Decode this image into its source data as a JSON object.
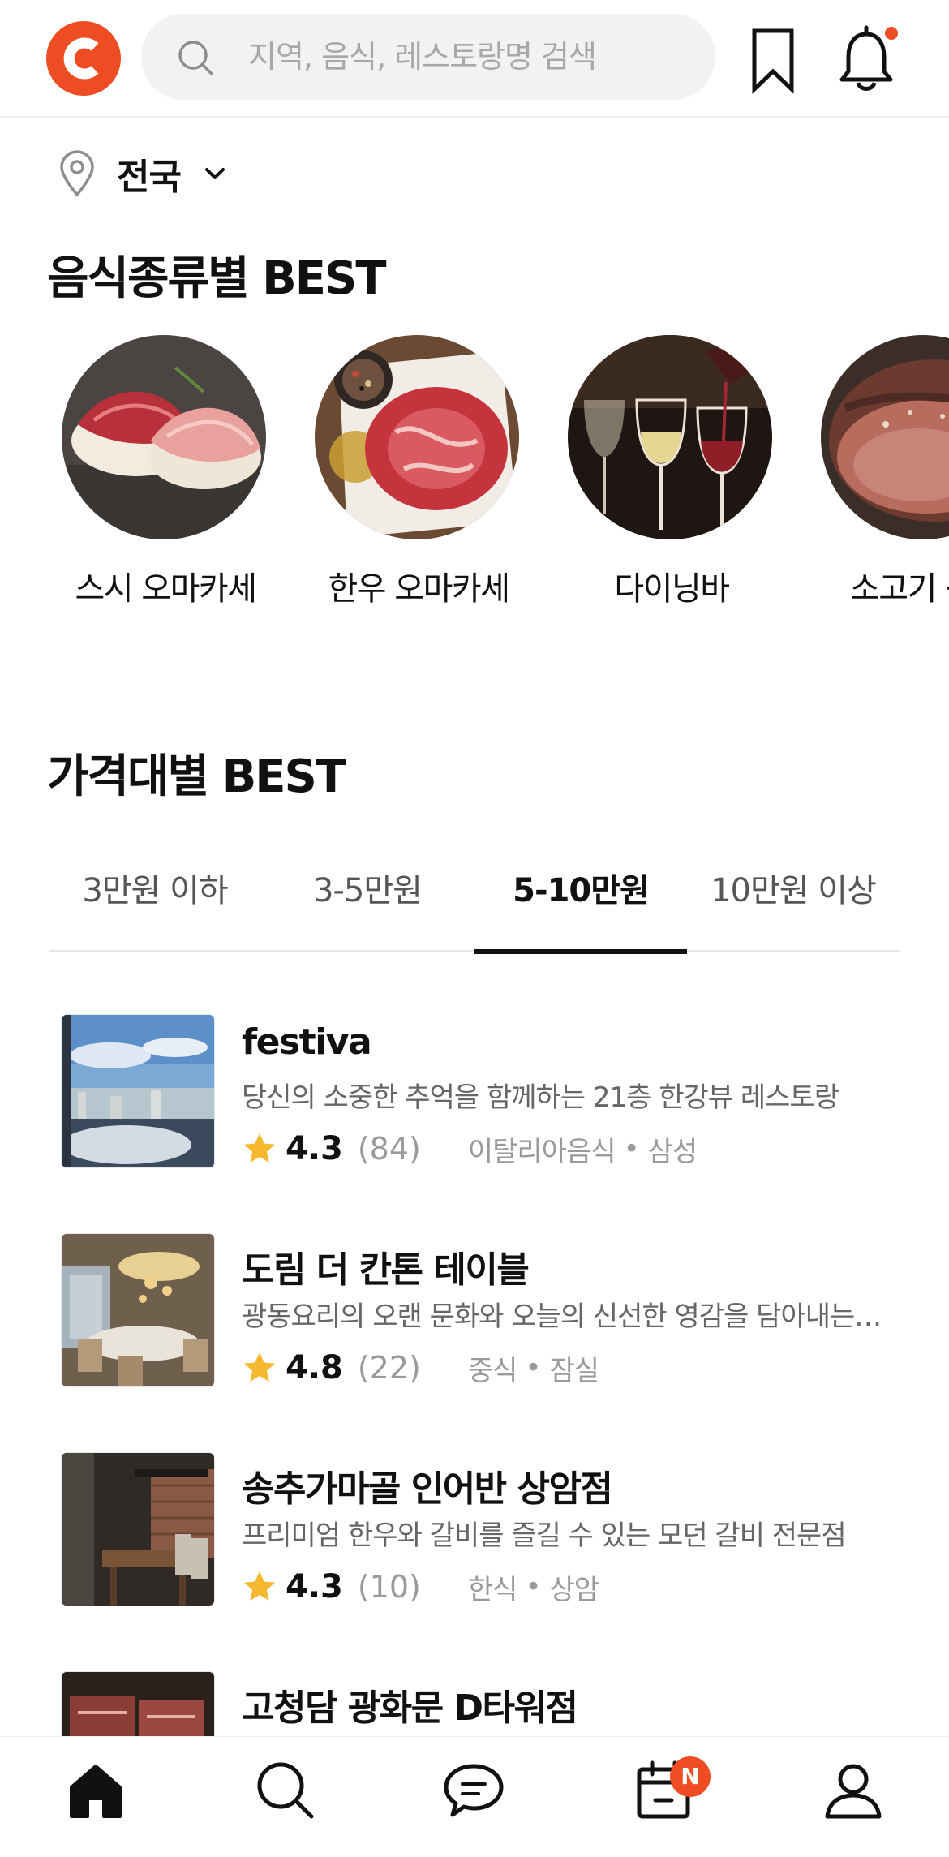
{
  "header": {
    "logo_letter": "C",
    "search_placeholder": "지역, 음식, 레스토랑명 검색",
    "brand_color": "#ee4c22"
  },
  "region": {
    "label": "전국"
  },
  "category_section": {
    "title": "음식종류별 BEST",
    "items": [
      {
        "label": "스시 오마카세",
        "icon": "sushi-photo"
      },
      {
        "label": "한우 오마카세",
        "icon": "raw-beef-photo"
      },
      {
        "label": "다이닝바",
        "icon": "wine-glasses-photo"
      },
      {
        "label": "소고기 구",
        "icon": "steak-photo"
      }
    ]
  },
  "price_section": {
    "title": "가격대별 BEST",
    "tabs": [
      {
        "label": "3만원 이하",
        "active": false
      },
      {
        "label": "3-5만원",
        "active": false
      },
      {
        "label": "5-10만원",
        "active": true
      },
      {
        "label": "10만원 이상",
        "active": false
      }
    ]
  },
  "restaurants": [
    {
      "name": "festiva",
      "desc": "당신의 소중한 추억을 함께하는 21층 한강뷰 레스토랑",
      "rating": "4.3",
      "count": "(84)",
      "cuisine": "이탈리아음식",
      "area": "삼성"
    },
    {
      "name": "도림 더 칸톤 테이블",
      "desc": "광동요리의 오랜 문화와 오늘의 신선한 영감을 담아내는 공간",
      "rating": "4.8",
      "count": "(22)",
      "cuisine": "중식",
      "area": "잠실"
    },
    {
      "name": "송추가마골 인어반 상암점",
      "desc": "프리미엄 한우와 갈비를 즐길 수 있는 모던 갈비 전문점",
      "rating": "4.3",
      "count": "(10)",
      "cuisine": "한식",
      "area": "상암"
    },
    {
      "name": "고청담 광화문 D타워점",
      "desc": "",
      "rating": "",
      "count": "",
      "cuisine": "",
      "area": ""
    }
  ],
  "meta_separator": "•",
  "bottom_nav": {
    "items": [
      {
        "icon": "home-icon",
        "active": true
      },
      {
        "icon": "search-icon",
        "active": false
      },
      {
        "icon": "chat-icon",
        "active": false
      },
      {
        "icon": "calendar-icon",
        "active": false
      },
      {
        "icon": "profile-icon",
        "active": false
      }
    ],
    "badge": "N"
  },
  "colors": {
    "accent": "#ee4c22",
    "star": "#f5b82e",
    "text_muted": "#9a9a9a"
  }
}
